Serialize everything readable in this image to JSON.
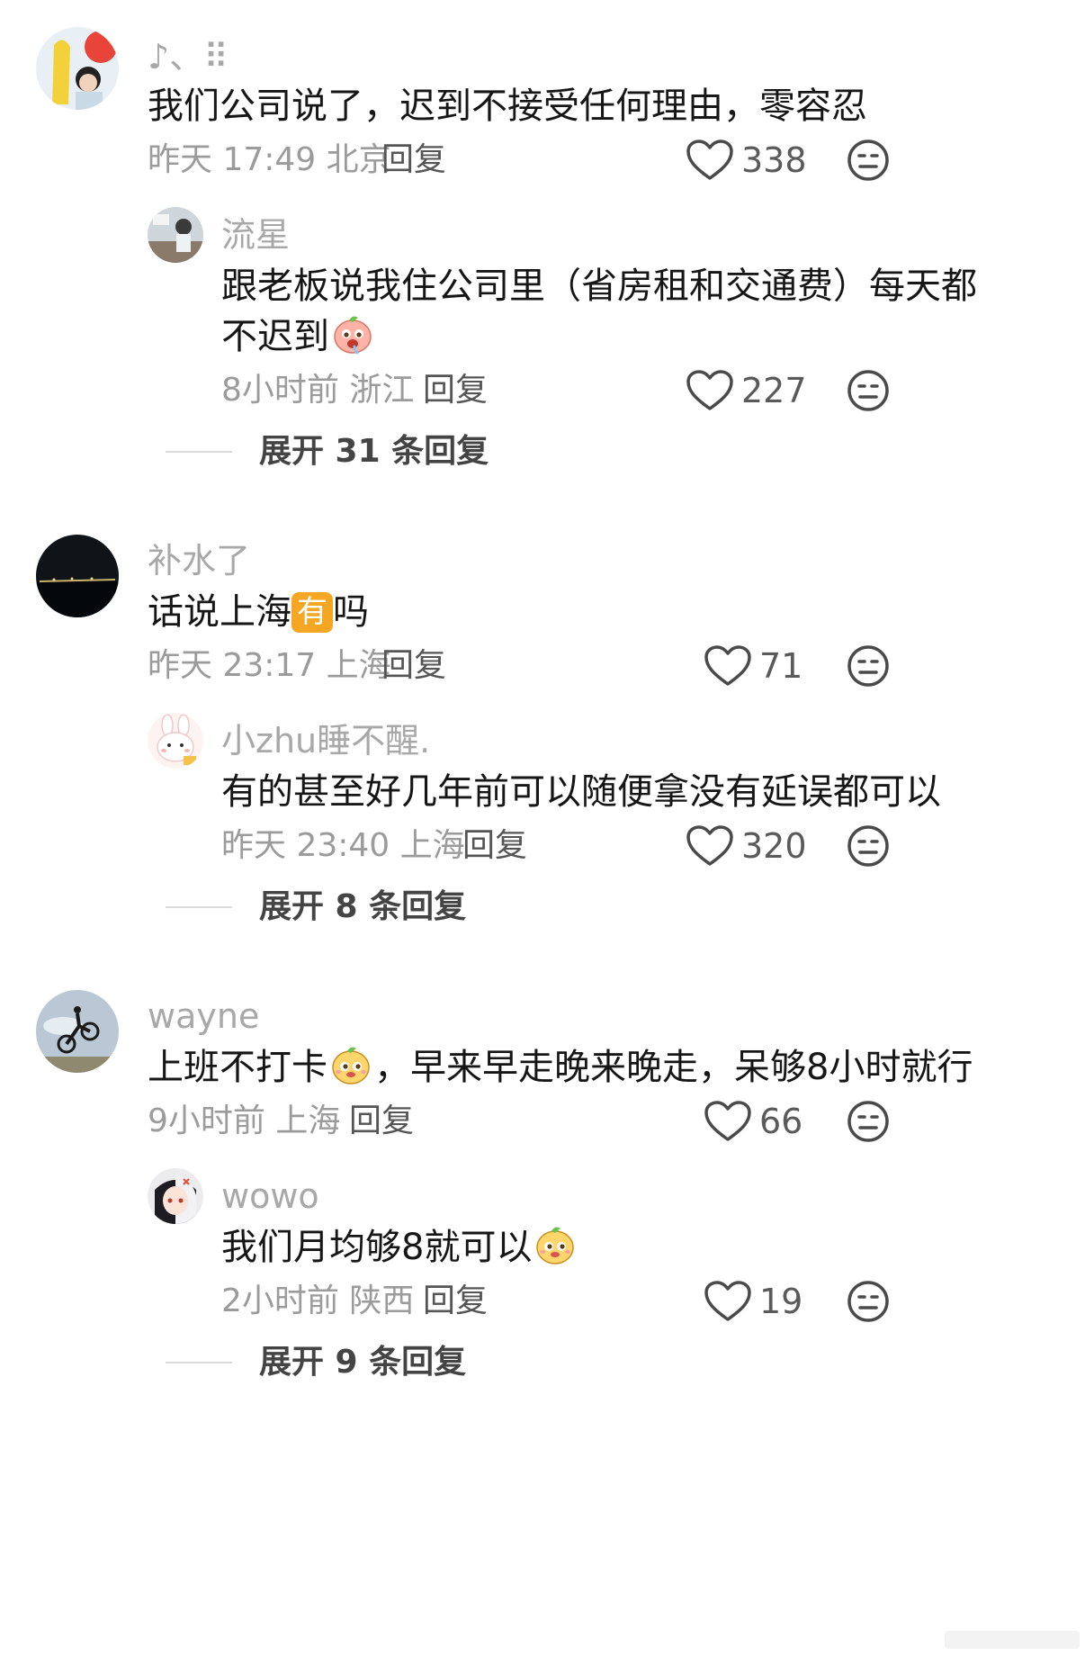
{
  "comments": [
    {
      "user": "♪、⠿",
      "text": "我们公司说了，迟到不接受任何理由，零容忍",
      "time": "昨天 17:49",
      "location": "北京",
      "reply_label": "回复",
      "likes": "338",
      "replies": [
        {
          "user": "流星",
          "text_line1": "跟老板说我住公司里（省房租和交通费）每天都",
          "text_line2": "不迟到",
          "emoji": "drooling-face-emoji",
          "time": "8小时前",
          "location": "浙江",
          "reply_label": "回复",
          "likes": "227"
        }
      ],
      "expand_label": "展开 31 条回复"
    },
    {
      "user": "补水了",
      "text_before": "话说上海",
      "badge": "有",
      "text_after": "吗",
      "time": "昨天 23:17",
      "location": "上海",
      "reply_label": "回复",
      "likes": "71",
      "replies": [
        {
          "user": "小zhu睡不醒.",
          "text": "有的甚至好几年前可以随便拿没有延误都可以",
          "time": "昨天 23:40",
          "location": "上海",
          "reply_label": "回复",
          "likes": "320"
        }
      ],
      "expand_label": "展开 8 条回复"
    },
    {
      "user": "wayne",
      "text_before": "上班不打卡",
      "emoji": "smug-face-emoji",
      "text_after": "，早来早走晚来晚走，呆够8小时就行",
      "time": "9小时前",
      "location": "上海",
      "reply_label": "回复",
      "likes": "66",
      "replies": [
        {
          "user": "wowo",
          "text": "我们月均够8就可以",
          "emoji": "smug-face-emoji",
          "time": "2小时前",
          "location": "陕西",
          "reply_label": "回复",
          "likes": "19"
        }
      ],
      "expand_label": "展开 9 条回复"
    }
  ]
}
